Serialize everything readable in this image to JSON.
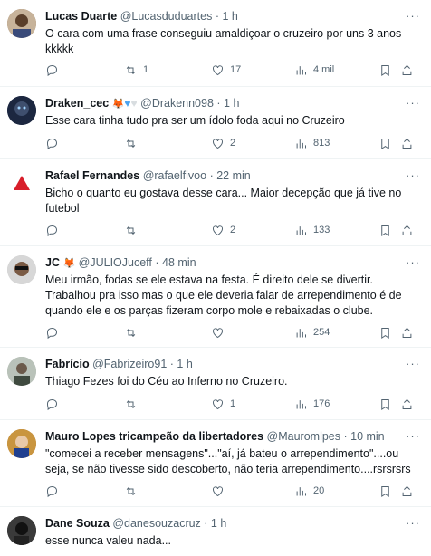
{
  "tweets": [
    {
      "name": "Lucas Duarte",
      "handle": "@Lucasduduartes",
      "time": "· 1 h",
      "text": "O cara com uma frase conseguiu amaldiçoar o cruzeiro por uns 3 anos kkkkk",
      "replies": "",
      "retweets": "1",
      "likes": "17",
      "views": "4 mil",
      "avatar_color": "#8a6a4a"
    },
    {
      "name": "Draken_cec",
      "name_emojis": [
        "fox-icon",
        "blue-heart-icon",
        "white-heart-icon"
      ],
      "handle": "@Drakenn098",
      "time": "· 1 h",
      "text": "Esse cara tinha tudo pra ser um ídolo foda aqui no Cruzeiro",
      "replies": "",
      "retweets": "",
      "likes": "2",
      "views": "813",
      "avatar_color": "#1f2a44"
    },
    {
      "name": "Rafael Fernandes",
      "handle": "@rafaelfivoo",
      "time": "· 22 min",
      "text": "Bicho o quanto eu gostava desse cara... Maior decepção que já tive no futebol",
      "replies": "",
      "retweets": "",
      "likes": "2",
      "views": "133",
      "avatar_color": "#ffffff"
    },
    {
      "name": "JC",
      "name_emojis": [
        "fox-icon"
      ],
      "handle": "@JULIOJuceff",
      "time": "· 48 min",
      "text": "Meu irmão, fodas se ele estava na festa. É direito dele se divertir. Trabalhou pra isso mas o que ele deveria falar de arrependimento é de quando ele e os parças fizeram corpo mole e rebaixadas o clube.",
      "replies": "",
      "retweets": "",
      "likes": "",
      "views": "254",
      "avatar_color": "#c9c9c9"
    },
    {
      "name": "Fabrício",
      "handle": "@Fabrizeiro91",
      "time": "· 1 h",
      "text": "Thiago Fezes foi do Céu ao Inferno no Cruzeiro.",
      "replies": "",
      "retweets": "",
      "likes": "1",
      "views": "176",
      "avatar_color": "#a7b0a8"
    },
    {
      "name": "Mauro Lopes tricampeão da libertadores",
      "handle": "@Mauromlpes",
      "time": "· 10 min",
      "text": "\"comecei a receber mensagens\"...\"aí, já bateu o arrependimento\"....ou seja, se não tivesse sido descoberto, não teria arrependimento....rsrsrsrs",
      "replies": "",
      "retweets": "",
      "likes": "",
      "views": "20",
      "avatar_color": "#b07a3a"
    },
    {
      "name": "Dane Souza",
      "handle": "@danesouzacruz",
      "time": "· 1 h",
      "text": "esse nunca valeu nada...",
      "avatar_color": "#2b2b2b"
    }
  ]
}
